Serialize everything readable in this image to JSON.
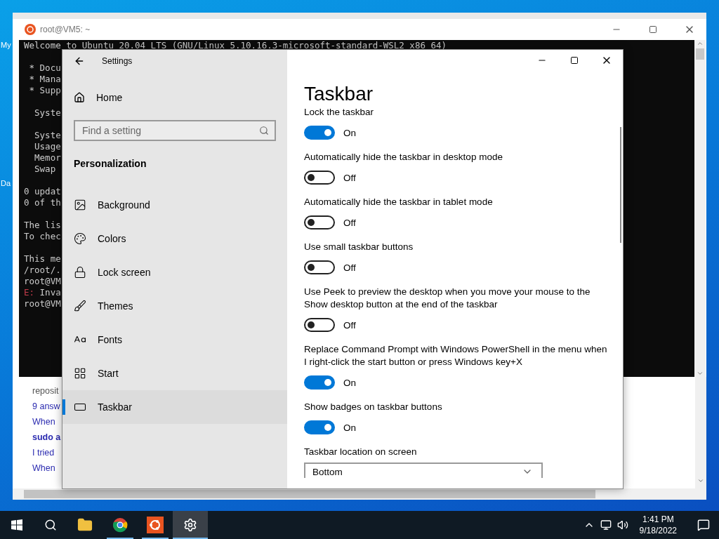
{
  "desktop": {
    "icon_labels": [
      "My",
      "Da"
    ]
  },
  "browser_window": {
    "lines": [
      {
        "text": "reposit",
        "kind": "plain"
      },
      {
        "text": "9 answ",
        "kind": "link"
      },
      {
        "text": "When",
        "kind": "link"
      },
      {
        "text": "sudo a",
        "kind": "bold"
      },
      {
        "text": "I tried",
        "kind": "link"
      },
      {
        "text": "When",
        "kind": "link"
      }
    ]
  },
  "terminal_window": {
    "title": "root@VM5: ~",
    "blocks": [
      {
        "lines": [
          {
            "text": "Welcome to Ubuntu 20.04 LTS (GNU/Linux 5.10.16.3-microsoft-standard-WSL2 x86_64)"
          }
        ]
      },
      {
        "lines": [
          {
            "text": " * Docu"
          },
          {
            "text": " * Mana"
          },
          {
            "text": " * Supp"
          }
        ]
      },
      {
        "lines": [
          {
            "text": "  Syste"
          }
        ]
      },
      {
        "lines": [
          {
            "text": "  Syste"
          },
          {
            "text": "  Usage"
          },
          {
            "text": "  Memor"
          },
          {
            "text": "  Swap"
          }
        ]
      },
      {
        "lines": [
          {
            "text": "0 updat"
          },
          {
            "text": "0 of th"
          }
        ]
      },
      {
        "lines": [
          {
            "text": "The lis"
          },
          {
            "text": "To chec"
          }
        ]
      },
      {
        "lines": [
          {
            "text": "This me"
          },
          {
            "text": "/root/."
          },
          {
            "text": "root@VM"
          },
          {
            "error_prefix": "E:",
            "text": " Inva"
          },
          {
            "text": "root@VM"
          }
        ]
      }
    ]
  },
  "settings_window": {
    "title": "Settings",
    "home": "Home",
    "search": {
      "placeholder": "Find a setting"
    },
    "section": "Personalization",
    "nav_items": [
      {
        "label": "Background",
        "selected": false
      },
      {
        "label": "Colors",
        "selected": false
      },
      {
        "label": "Lock screen",
        "selected": false
      },
      {
        "label": "Themes",
        "selected": false
      },
      {
        "label": "Fonts",
        "selected": false
      },
      {
        "label": "Start",
        "selected": false
      },
      {
        "label": "Taskbar",
        "selected": true
      }
    ],
    "page_title": "Taskbar",
    "settings": [
      {
        "kind": "toggle",
        "label": "Lock the taskbar",
        "on": true,
        "status": "On"
      },
      {
        "kind": "toggle",
        "label": "Automatically hide the taskbar in desktop mode",
        "on": false,
        "status": "Off"
      },
      {
        "kind": "toggle",
        "label": "Automatically hide the taskbar in tablet mode",
        "on": false,
        "status": "Off"
      },
      {
        "kind": "toggle",
        "label": "Use small taskbar buttons",
        "on": false,
        "status": "Off"
      },
      {
        "kind": "toggle",
        "label": "Use Peek to preview the desktop when you move your mouse to the Show desktop button at the end of the taskbar",
        "on": false,
        "status": "Off"
      },
      {
        "kind": "toggle",
        "label": "Replace Command Prompt with Windows PowerShell in the menu when I right-click the start button or press Windows key+X",
        "on": true,
        "status": "On"
      },
      {
        "kind": "toggle",
        "label": "Show badges on taskbar buttons",
        "on": true,
        "status": "On"
      },
      {
        "kind": "dropdown",
        "label": "Taskbar location on screen",
        "value": "Bottom"
      }
    ]
  },
  "taskbar": {
    "apps": [
      {
        "kind": "explorer",
        "running": false,
        "active": false
      },
      {
        "kind": "chrome",
        "running": true,
        "active": false
      },
      {
        "kind": "ubuntu",
        "running": true,
        "active": false
      },
      {
        "kind": "settings",
        "running": true,
        "active": true
      }
    ],
    "time": "1:41 PM",
    "date": "9/18/2022"
  }
}
